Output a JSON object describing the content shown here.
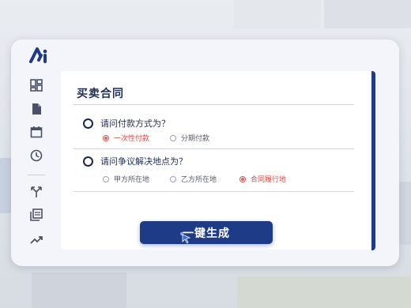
{
  "colors": {
    "brand": "#1d3b86",
    "accent": "#1f3b86",
    "selected": "#e0625c",
    "text_dark": "#1f2d55"
  },
  "logo": {
    "icon": "ai-logo-icon"
  },
  "sidebar": {
    "items": [
      {
        "icon": "dashboard-icon"
      },
      {
        "icon": "document-icon"
      },
      {
        "icon": "calendar-icon"
      },
      {
        "icon": "clock-icon"
      },
      {
        "icon": "share-arrows-icon"
      },
      {
        "icon": "stack-document-icon"
      },
      {
        "icon": "trend-up-icon"
      }
    ]
  },
  "form": {
    "title": "买卖合同",
    "questions": [
      {
        "text": "请问付款方式为？",
        "options": [
          {
            "label": "一次性付款",
            "selected": true
          },
          {
            "label": "分期付款",
            "selected": false
          }
        ]
      },
      {
        "text": "请问争议解决地点为？",
        "options": [
          {
            "label": "甲方所在地",
            "selected": false
          },
          {
            "label": "乙方所在地",
            "selected": false
          },
          {
            "label": "合同履行地",
            "selected": true
          }
        ]
      }
    ],
    "generate_label": "一键生成"
  }
}
